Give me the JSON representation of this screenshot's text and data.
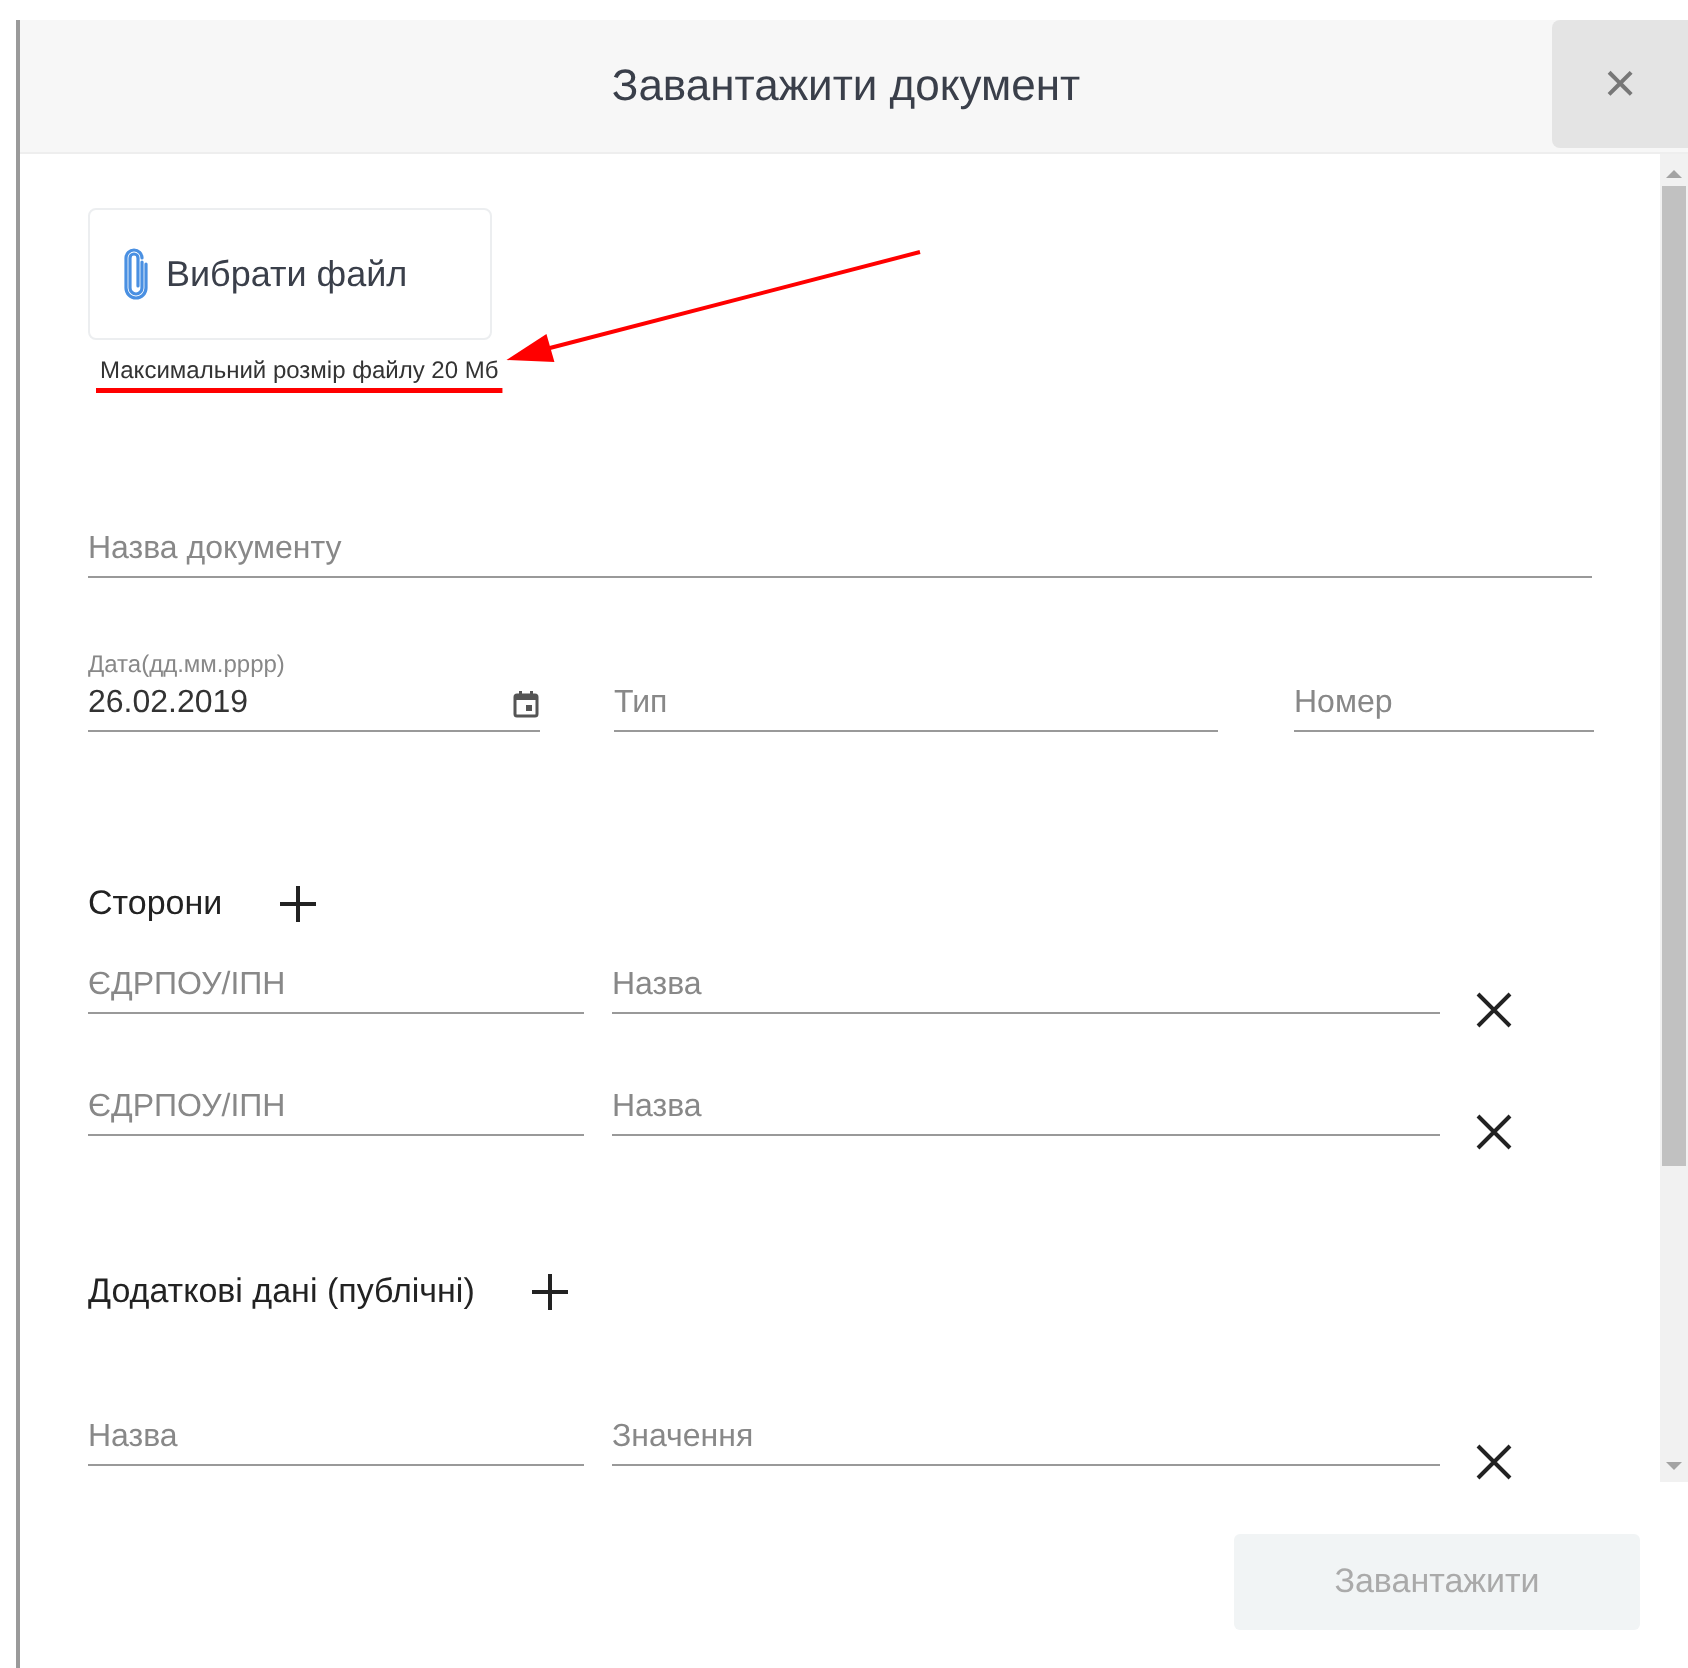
{
  "dialog": {
    "title": "Завантажити документ",
    "close": "×"
  },
  "file_button": {
    "label": "Вибрати файл"
  },
  "file_hint": "Максимальний розмір файлу 20 Мб",
  "annotations": {
    "arrow": {
      "color": "#ff0000"
    },
    "underline": {
      "color": "#ff0000"
    }
  },
  "fields": {
    "name": {
      "placeholder": "Назва документу"
    },
    "date": {
      "label": "Дата(дд.мм.рррр)",
      "value": "26.02.2019"
    },
    "type": {
      "placeholder": "Тип"
    },
    "number": {
      "placeholder": "Номер"
    }
  },
  "parties": {
    "title": "Сторони",
    "rows": [
      {
        "code": {
          "placeholder": "ЄДРПОУ/ІПН"
        },
        "name": {
          "placeholder": "Назва"
        }
      },
      {
        "code": {
          "placeholder": "ЄДРПОУ/ІПН"
        },
        "name": {
          "placeholder": "Назва"
        }
      }
    ]
  },
  "extra": {
    "title": "Додаткові дані (публічні)",
    "rows": [
      {
        "key": {
          "placeholder": "Назва"
        },
        "value": {
          "placeholder": "Значення"
        }
      }
    ]
  },
  "submit": {
    "label": "Завантажити",
    "disabled": true
  }
}
